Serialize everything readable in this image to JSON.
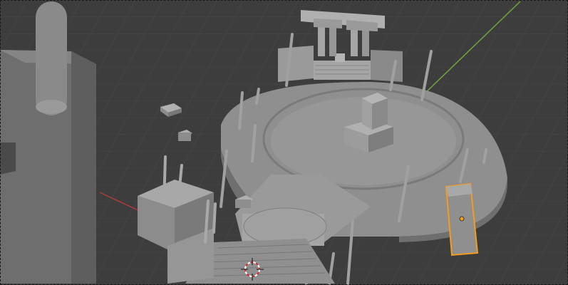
{
  "viewport": {
    "background": "#3d3d3d",
    "grid_color": "#4a4a4a",
    "x_axis_color": "#b23a3a",
    "y_axis_color": "#6fa53a",
    "selection_outline_color": "#f39c1f",
    "origin_dot_color": "#f39c1f",
    "icons": [
      "3d-cursor-icon",
      "origin-dot-icon"
    ]
  }
}
